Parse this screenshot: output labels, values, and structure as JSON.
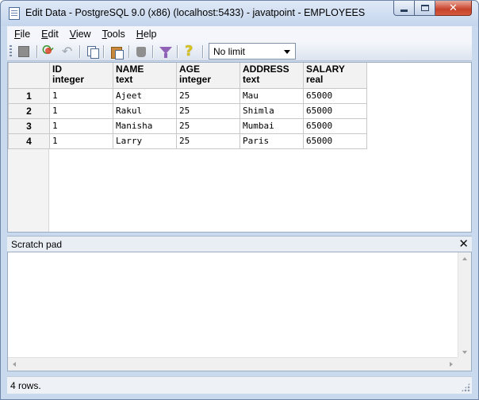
{
  "window": {
    "title": "Edit Data - PostgreSQL 9.0 (x86) (localhost:5433) - javatpoint - EMPLOYEES",
    "close_glyph": "✕"
  },
  "menu": {
    "items": [
      {
        "label": "File",
        "accel": "F",
        "rest": "ile"
      },
      {
        "label": "Edit",
        "accel": "E",
        "rest": "dit"
      },
      {
        "label": "View",
        "accel": "V",
        "rest": "iew"
      },
      {
        "label": "Tools",
        "accel": "T",
        "rest": "ools"
      },
      {
        "label": "Help",
        "accel": "H",
        "rest": "elp"
      }
    ]
  },
  "toolbar": {
    "icons": [
      "stop-icon",
      "refresh-icon",
      "undo-icon",
      "copy-icon",
      "paste-icon",
      "delete-icon",
      "filter-icon",
      "help-icon"
    ],
    "row_limit": "No limit"
  },
  "grid": {
    "columns": [
      {
        "name": "ID",
        "type": "integer"
      },
      {
        "name": "NAME",
        "type": "text"
      },
      {
        "name": "AGE",
        "type": "integer"
      },
      {
        "name": "ADDRESS",
        "type": "text"
      },
      {
        "name": "SALARY",
        "type": "real"
      }
    ],
    "rows": [
      {
        "num": "1",
        "cells": [
          "1",
          "Ajeet",
          "25",
          "Mau",
          "65000"
        ]
      },
      {
        "num": "2",
        "cells": [
          "1",
          "Rakul",
          "25",
          "Shimla",
          "65000"
        ]
      },
      {
        "num": "3",
        "cells": [
          "1",
          "Manisha",
          "25",
          "Mumbai",
          "65000"
        ]
      },
      {
        "num": "4",
        "cells": [
          "1",
          "Larry",
          "25",
          "Paris",
          "65000"
        ]
      }
    ]
  },
  "scratch_pad": {
    "title": "Scratch pad",
    "close_glyph": "✕",
    "content": ""
  },
  "status": {
    "text": "4 rows."
  },
  "colors": {
    "title_bar": "#c4d5ec",
    "close_button": "#c7422a",
    "header_bg": "#f2f2f2"
  }
}
